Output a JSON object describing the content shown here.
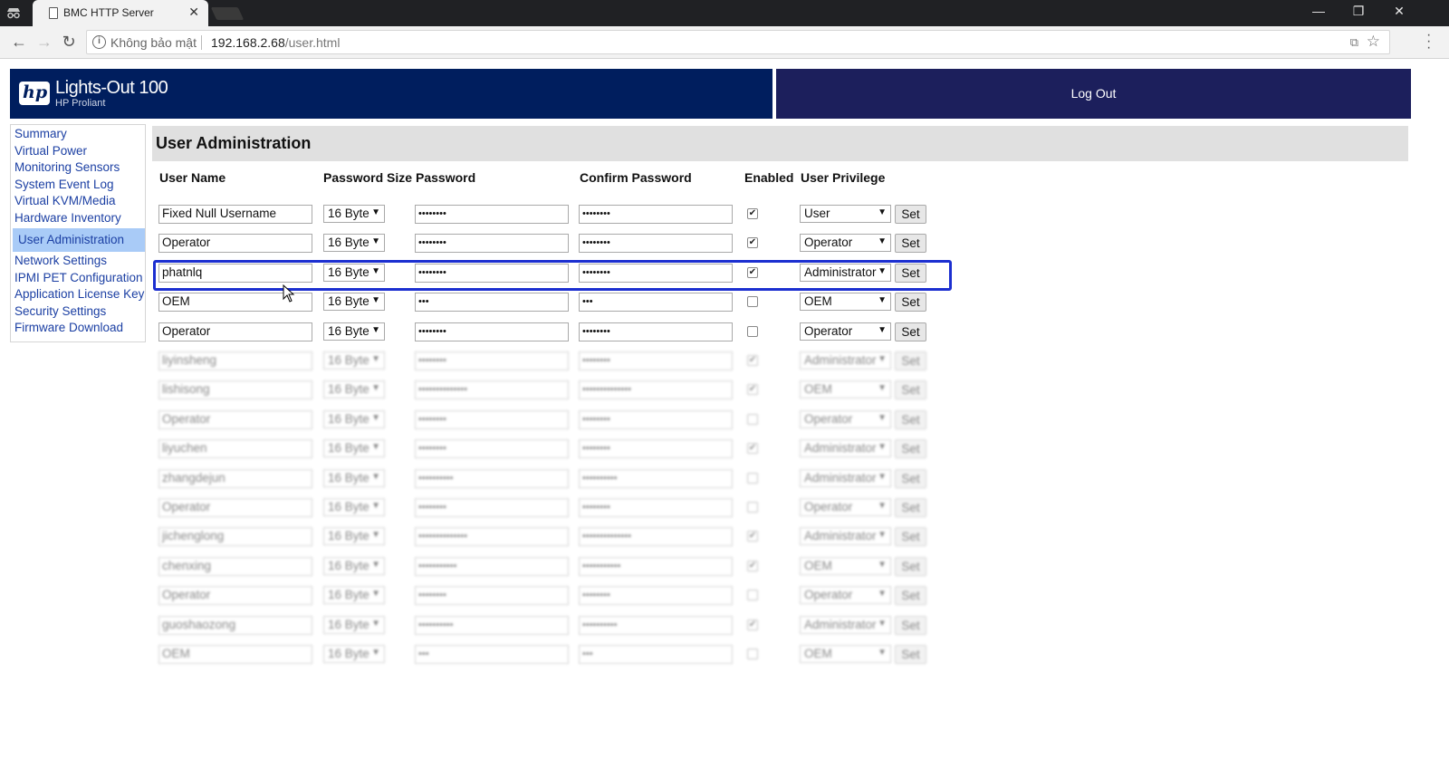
{
  "browser": {
    "tab_title": "BMC HTTP Server",
    "security_label": "Không bảo mật",
    "url_host": "192.168.2.68",
    "url_path": "/user.html"
  },
  "header": {
    "logo_text": "hp",
    "product_name": "Lights-Out 100",
    "product_sub": "HP Proliant",
    "logout_label": "Log Out"
  },
  "sidebar": {
    "items": [
      {
        "label": "Summary"
      },
      {
        "label": "Virtual Power"
      },
      {
        "label": "Monitoring Sensors"
      },
      {
        "label": "System Event Log"
      },
      {
        "label": "Virtual KVM/Media"
      },
      {
        "label": "Hardware Inventory"
      },
      {
        "label": "User Administration",
        "active": true
      },
      {
        "label": "Network Settings"
      },
      {
        "label": "IPMI PET Configuration"
      },
      {
        "label": "Application License Key"
      },
      {
        "label": "Security Settings"
      },
      {
        "label": "Firmware Download"
      }
    ]
  },
  "main": {
    "title": "User Administration",
    "columns": {
      "user_name": "User Name",
      "password_size": "Password Size",
      "password": "Password",
      "confirm_password": "Confirm Password",
      "enabled": "Enabled",
      "user_privilege": "User Privilege"
    },
    "set_label": "Set",
    "users": [
      {
        "name": "Fixed Null Username",
        "size": "16 Byte",
        "password": "••••••••",
        "confirm": "••••••••",
        "enabled": true,
        "privilege": "User"
      },
      {
        "name": "Operator",
        "size": "16 Byte",
        "password": "••••••••",
        "confirm": "••••••••",
        "enabled": true,
        "privilege": "Operator"
      },
      {
        "name": "phatnlq",
        "size": "16 Byte",
        "password": "••••••••",
        "confirm": "••••••••",
        "enabled": true,
        "privilege": "Administrator",
        "highlighted": true
      },
      {
        "name": "OEM",
        "size": "16 Byte",
        "password": "•••",
        "confirm": "•••",
        "enabled": false,
        "privilege": "OEM"
      },
      {
        "name": "Operator",
        "size": "16 Byte",
        "password": "••••••••",
        "confirm": "••••••••",
        "enabled": false,
        "privilege": "Operator"
      }
    ],
    "blurred_users": [
      {
        "name": "liyinsheng",
        "size": "16 Byte",
        "password": "••••••••",
        "confirm": "••••••••",
        "enabled": true,
        "privilege": "Administrator"
      },
      {
        "name": "lishisong",
        "size": "16 Byte",
        "password": "••••••••••••••",
        "confirm": "••••••••••••••",
        "enabled": true,
        "privilege": "OEM"
      },
      {
        "name": "Operator",
        "size": "16 Byte",
        "password": "••••••••",
        "confirm": "••••••••",
        "enabled": false,
        "privilege": "Operator"
      },
      {
        "name": "liyuchen",
        "size": "16 Byte",
        "password": "••••••••",
        "confirm": "••••••••",
        "enabled": true,
        "privilege": "Administrator"
      },
      {
        "name": "zhangdejun",
        "size": "16 Byte",
        "password": "••••••••••",
        "confirm": "••••••••••",
        "enabled": false,
        "privilege": "Administrator"
      },
      {
        "name": "Operator",
        "size": "16 Byte",
        "password": "••••••••",
        "confirm": "••••••••",
        "enabled": false,
        "privilege": "Operator"
      },
      {
        "name": "jichenglong",
        "size": "16 Byte",
        "password": "••••••••••••••",
        "confirm": "••••••••••••••",
        "enabled": true,
        "privilege": "Administrator"
      },
      {
        "name": "chenxing",
        "size": "16 Byte",
        "password": "•••••••••••",
        "confirm": "•••••••••••",
        "enabled": true,
        "privilege": "OEM"
      },
      {
        "name": "Operator",
        "size": "16 Byte",
        "password": "••••••••",
        "confirm": "••••••••",
        "enabled": false,
        "privilege": "Operator"
      },
      {
        "name": "guoshaozong",
        "size": "16 Byte",
        "password": "••••••••••",
        "confirm": "••••••••••",
        "enabled": true,
        "privilege": "Administrator"
      },
      {
        "name": "OEM",
        "size": "16 Byte",
        "password": "•••",
        "confirm": "•••",
        "enabled": false,
        "privilege": "OEM"
      }
    ]
  }
}
